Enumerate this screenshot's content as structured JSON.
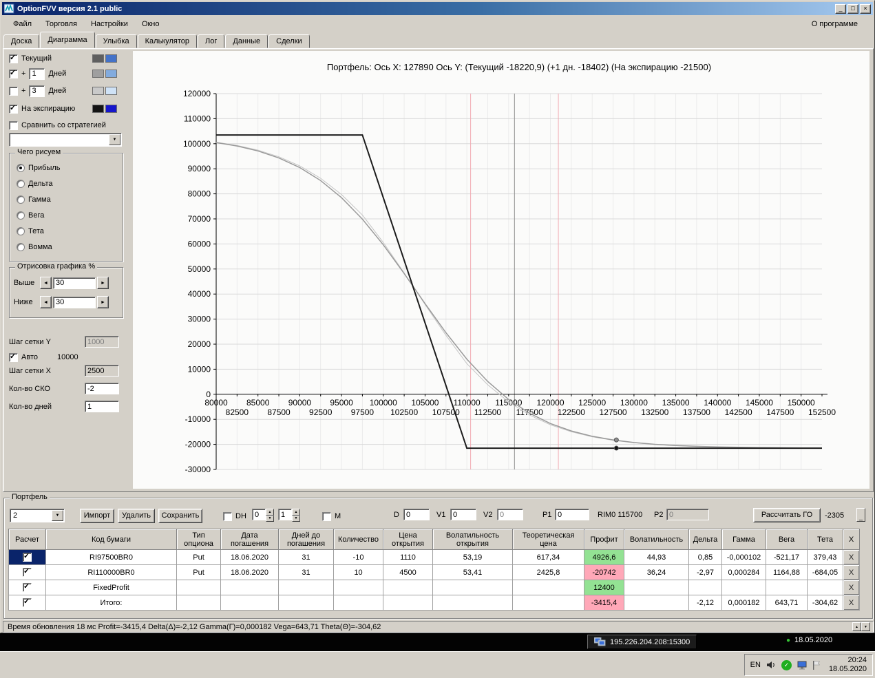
{
  "window": {
    "title": "OptionFVV версия 2.1 public",
    "menu": [
      "Файл",
      "Торговля",
      "Настройки",
      "Окно"
    ],
    "menu_right": "О программе"
  },
  "icons": {
    "minimize": "_",
    "maximize": "□",
    "close": "×",
    "dropdown": "▼",
    "check": "✓",
    "spin_up": "▲",
    "spin_down": "▼",
    "arrow_left": "◄",
    "arrow_right": "►",
    "green_dot": "●"
  },
  "tabs": {
    "items": [
      "Доска",
      "Диаграмма",
      "Улыбка",
      "Калькулятор",
      "Лог",
      "Данные",
      "Сделки"
    ],
    "active": "Диаграмма"
  },
  "left_panel": {
    "rows": [
      {
        "label": "Текущий",
        "checked": true,
        "colors": [
          "#5f5f5f",
          "#4472c8"
        ]
      },
      {
        "prefix": "+",
        "days": "1",
        "label": "Дней",
        "checked": true,
        "colors": [
          "#9f9f9f",
          "#82abde"
        ]
      },
      {
        "prefix": "+",
        "days": "3",
        "label": "Дней",
        "checked": false,
        "colors": [
          "#c9c9c9",
          "#cfe2f6"
        ]
      },
      {
        "label": "На экспирацию",
        "checked": true,
        "colors": [
          "#141414",
          "#1616cc"
        ]
      }
    ],
    "compare": {
      "label": "Сравнить со стратегией",
      "checked": false
    },
    "strategy_value": "",
    "draw_group": {
      "title": "Чего рисуем",
      "options": [
        {
          "label": "Прибыль",
          "selected": true
        },
        {
          "label": "Дельта",
          "selected": false
        },
        {
          "label": "Гамма",
          "selected": false
        },
        {
          "label": "Вега",
          "selected": false
        },
        {
          "label": "Тета",
          "selected": false
        },
        {
          "label": "Вомма",
          "selected": false
        }
      ]
    },
    "render_group": {
      "title": "Отрисовка графика %",
      "above_label": "Выше",
      "above_value": "30",
      "below_label": "Ниже",
      "below_value": "30"
    },
    "grid_y": {
      "label": "Шаг сетки Y",
      "value": "1000"
    },
    "auto": {
      "label": "Авто",
      "checked": true,
      "value": "10000"
    },
    "grid_x": {
      "label": "Шаг сетки X",
      "value": "2500"
    },
    "cko": {
      "label": "Кол-во СКО",
      "value": "-2"
    },
    "days": {
      "label": "Кол-во дней",
      "value": "1"
    }
  },
  "chart_data": {
    "type": "line",
    "title": "Портфель: Ось X: 127890 Ось Y:  (Текущий -18220,9)  (+1 дн. -18402)  (На экспирацию -21500)",
    "xlim": [
      80000,
      152500
    ],
    "ylim": [
      -30000,
      120000
    ],
    "x_step": 2500,
    "y_step": 10000,
    "series": [
      {
        "name": "Текущий",
        "role": "current",
        "color": "#9a9a9a",
        "width": 1.5,
        "x": [
          80000,
          82500,
          85000,
          87500,
          90000,
          92500,
          95000,
          97500,
          100000,
          102500,
          105000,
          107500,
          110000,
          112500,
          115000,
          117500,
          120000,
          122500,
          125000,
          127500,
          130000,
          132500,
          135000,
          137500,
          140000,
          142500,
          145000,
          147500,
          150000,
          152500
        ],
        "y": [
          100460,
          99090,
          97120,
          94350,
          90500,
          85290,
          78465,
          69885,
          59648,
          48180,
          36200,
          24568,
          14041,
          5108,
          -2066,
          -7579,
          -11675,
          -14640,
          -16747,
          -18225,
          -19252,
          -19961,
          -20448,
          -20782,
          -21010,
          -21166,
          -21273,
          -21345,
          -21395,
          -21428
        ]
      },
      {
        "name": "+1 день",
        "role": "plus1",
        "color": "#c4c4c4",
        "width": 1,
        "blend_toward_expiration": 0.05
      },
      {
        "name": "На экспирацию",
        "role": "expiration",
        "color": "#1c1c1c",
        "width": 2,
        "x": [
          80000,
          97500,
          110000,
          152500
        ],
        "y": [
          103500,
          103500,
          -21500,
          -21500
        ]
      }
    ],
    "vlines": [
      {
        "x": 110450,
        "color": "#f2aab2",
        "name": "cko-lower"
      },
      {
        "x": 120950,
        "color": "#f2aab2",
        "name": "cko-upper"
      },
      {
        "x": 115700,
        "color": "#8f8f8f",
        "name": "current-price"
      }
    ],
    "markers": [
      {
        "x": 127890,
        "y": -18220.9,
        "color": "#8f8f8f"
      },
      {
        "x": 127890,
        "y": -21500,
        "color": "#111111"
      }
    ],
    "cursor": {
      "x": 127890,
      "current": -18220.9,
      "plus1": -18402,
      "expiration": -21500
    }
  },
  "portfolio": {
    "group_title": "Портфель",
    "selector": "2",
    "import_label": "Импорт",
    "delete_label": "Удалить",
    "save_label": "Сохранить",
    "dh": {
      "label": "DH",
      "checked": false,
      "spin1": "0",
      "spin2": "1"
    },
    "m": {
      "label": "M",
      "checked": false
    },
    "d": {
      "label": "D",
      "value": "0"
    },
    "v1": {
      "label": "V1",
      "value": "0"
    },
    "v2": {
      "label": "V2",
      "value": "0"
    },
    "p1": {
      "label": "P1",
      "value": "0"
    },
    "instrument": "RIM0 115700",
    "p2": {
      "label": "P2",
      "value": "0"
    },
    "calc_button": "Рассчитать ГО",
    "calc_value": "-2305",
    "table": {
      "delete_label": "X",
      "headers": [
        "Расчет",
        "Код бумаги",
        "Тип опциона",
        "Дата погашения",
        "Дней до погашения",
        "Количество",
        "Цена открытия",
        "Волатильность открытия",
        "Теоретическая цена",
        "Профит",
        "Волатильность",
        "Дельта",
        "Гамма",
        "Вега",
        "Тета",
        "X"
      ],
      "rows": [
        {
          "checked": true,
          "selected": true,
          "profit_state": "pos",
          "cells": [
            "RI97500BR0",
            "Put",
            "18.06.2020",
            "31",
            "-10",
            "1110",
            "53,19",
            "617,34",
            "4926,6",
            "44,93",
            "0,85",
            "-0,000102",
            "-521,17",
            "379,43"
          ]
        },
        {
          "checked": true,
          "selected": false,
          "profit_state": "neg",
          "cells": [
            "RI110000BR0",
            "Put",
            "18.06.2020",
            "31",
            "10",
            "4500",
            "53,41",
            "2425,8",
            "-20742",
            "36,24",
            "-2,97",
            "0,000284",
            "1164,88",
            "-684,05"
          ]
        },
        {
          "checked": true,
          "selected": false,
          "profit_state": "pos",
          "cells": [
            "FixedProfit",
            "",
            "",
            "",
            "",
            "",
            "",
            "",
            "12400",
            "",
            "",
            "",
            "",
            ""
          ]
        },
        {
          "checked": true,
          "selected": false,
          "profit_state": "neg",
          "cells": [
            "Итого:",
            "",
            "",
            "",
            "",
            "",
            "",
            "",
            "-3415,4",
            "",
            "-2,12",
            "0,000182",
            "643,71",
            "-304,62"
          ]
        }
      ]
    }
  },
  "statusbar": {
    "text": "Время обновления 18 мс  Profit=-3415,4 Delta(Δ)=-2,12 Gamma(Г)=0,000182 Vega=643,71 Theta(Θ)=-304,62"
  },
  "connection": {
    "address": "195.226.204.208:15300",
    "date": "18.05.2020"
  },
  "tray": {
    "lang": "EN",
    "time": "20:24",
    "date": "18.05.2020"
  }
}
